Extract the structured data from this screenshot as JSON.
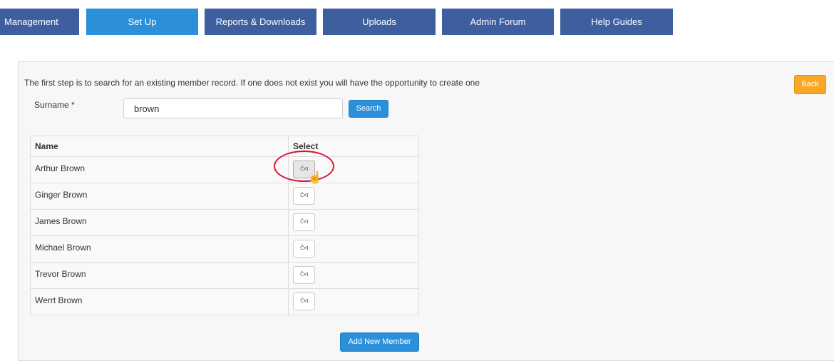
{
  "nav": {
    "items": [
      {
        "label": "Management"
      },
      {
        "label": "Set Up"
      },
      {
        "label": "Reports & Downloads"
      },
      {
        "label": "Uploads"
      },
      {
        "label": "Admin Forum"
      },
      {
        "label": "Help Guides"
      }
    ],
    "active": "Set Up"
  },
  "intro_text": "The first step is to search for an existing member record. If one does not exist you will have the opportunity to create one",
  "search": {
    "label": "Surname *",
    "value": "brown",
    "button_label": "Search"
  },
  "back_label": "Back",
  "table": {
    "headers": [
      "Name",
      "Select"
    ],
    "rows": [
      {
        "name": "Arthur Brown"
      },
      {
        "name": "Ginger Brown"
      },
      {
        "name": "James Brown"
      },
      {
        "name": "Michael Brown"
      },
      {
        "name": "Trevor Brown"
      },
      {
        "name": "Werrt Brown"
      }
    ]
  },
  "add_member_label": "Add New Member",
  "icons": {
    "select": "thumbs-up-icon",
    "cursor": "hand-pointer-icon"
  },
  "colors": {
    "nav": "#3d5fa0",
    "nav_active": "#2b90d9",
    "primary_button": "#2b90d9",
    "back_button": "#f9a825",
    "highlight_circle": "#d2163a"
  }
}
